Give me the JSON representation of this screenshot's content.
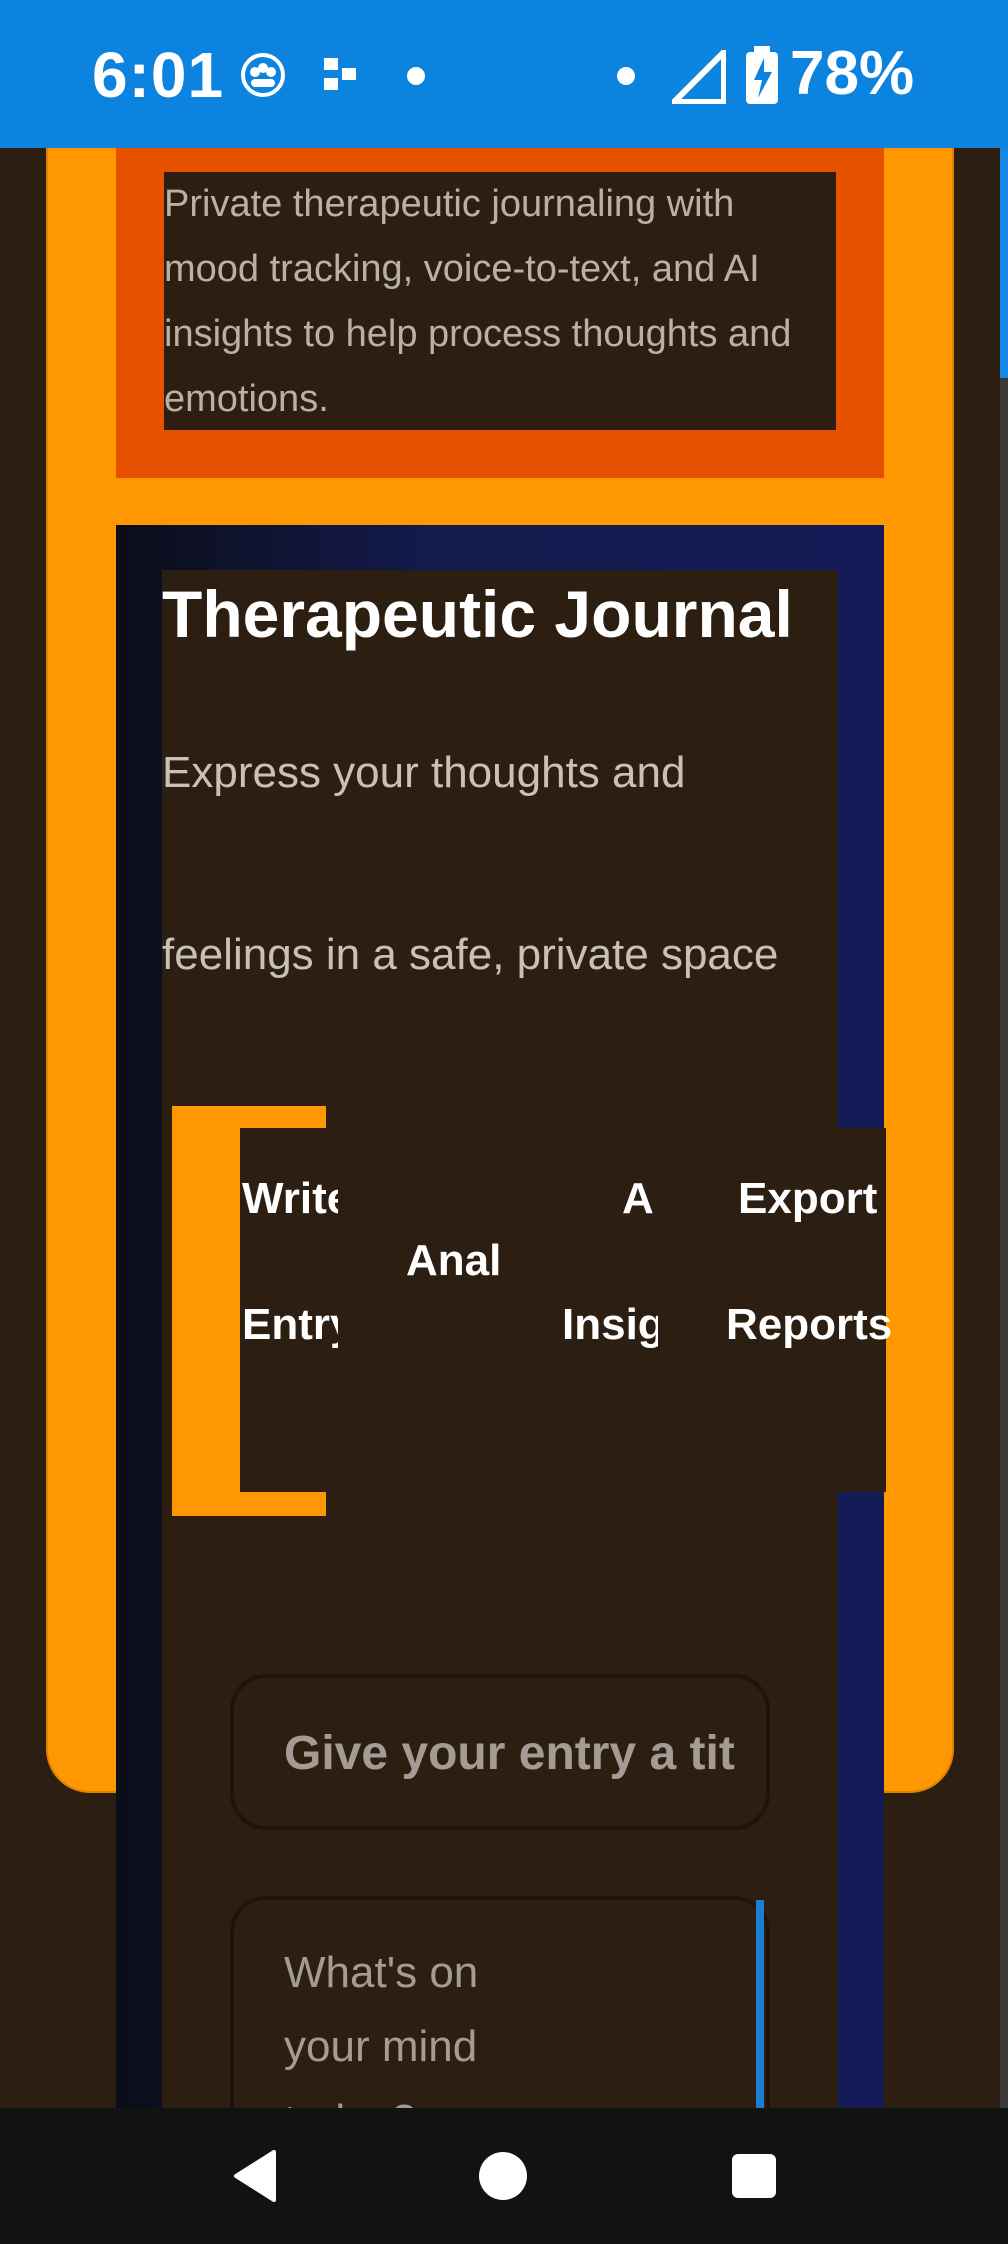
{
  "status_bar": {
    "time": "6:01",
    "battery_percent": "78%",
    "icons": [
      "people-icon",
      "dots-icon",
      "dot-icon",
      "dot-icon",
      "signal-icon",
      "battery-charging-icon"
    ],
    "background": "#0c83de"
  },
  "app": {
    "description": "Private therapeutic journaling with mood tracking, voice-to-text, and AI insights to help process thoughts and emotions.",
    "title": "Therapeutic Journal",
    "subtitle_line1": "Express your thoughts and",
    "subtitle_line2": "feelings in a safe, private space",
    "tabs": {
      "write": {
        "line1": "Write",
        "line2": "Entry"
      },
      "analysis": {
        "line1": "Anal"
      },
      "ai": {
        "line1": "AI",
        "line2": "Insig"
      },
      "export": {
        "line1": "Export",
        "line2": "Reports"
      }
    },
    "title_input": {
      "placeholder": "Give your entry a tit"
    },
    "body_input": {
      "placeholder": "What's on your mind today? Share"
    },
    "colors": {
      "page_bg": "#2c1f12",
      "card_orange": "#ff9800",
      "deep_orange": "#e65100",
      "navy": "#141a56"
    }
  },
  "nav_bar": {
    "buttons": [
      "back-icon",
      "home-icon",
      "recents-icon"
    ]
  }
}
